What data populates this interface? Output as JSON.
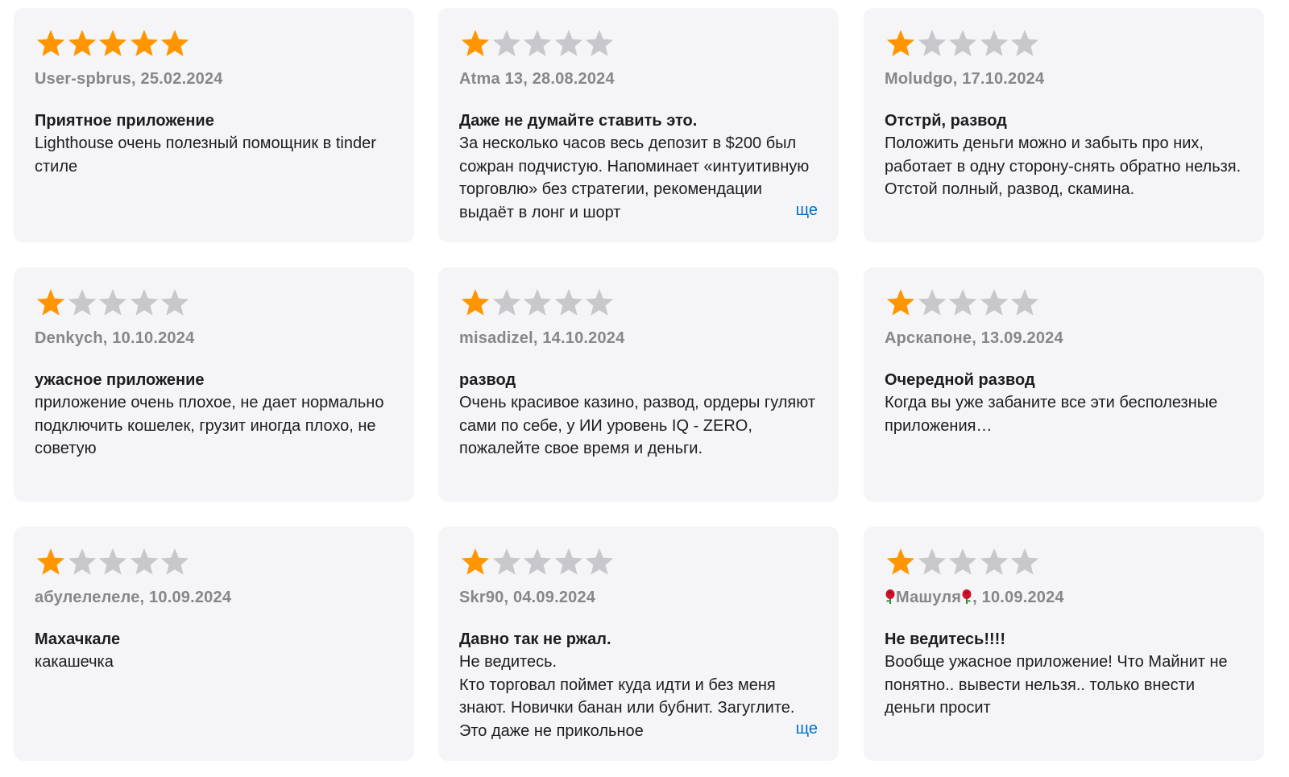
{
  "colors": {
    "star_filled": "#ff9500",
    "star_empty": "#c7c7cc",
    "link": "#0070c9"
  },
  "reviews": [
    {
      "rating": 5,
      "author": "User-spbrus",
      "date": "25.02.2024",
      "title": "Приятное приложение",
      "body": "Lighthouse очень полезный помощник в tinder стиле",
      "more": ""
    },
    {
      "rating": 1,
      "author": "Atma 13",
      "date": "28.08.2024",
      "title": "Даже не думайте ставить это.",
      "body": "За несколько часов весь депозит в $200 был сожран подчистую. Напоминает «интуитивную торговлю» без стратегии, рекомендации выдаёт в лонг и шорт",
      "more": "ще"
    },
    {
      "rating": 1,
      "author": "Moludgo",
      "date": "17.10.2024",
      "title": "Отстрй, развод",
      "body": "Положить деньги можно и забыть про них, работает в одну сторону-снять обратно нельзя. Отстой полный, развод, скамина.",
      "more": ""
    },
    {
      "rating": 1,
      "author": "Denkych",
      "date": "10.10.2024",
      "title": "ужасное приложение",
      "body": "приложение очень плохое, не дает нормально подключить кошелек, грузит иногда плохо, не советую",
      "more": ""
    },
    {
      "rating": 1,
      "author": "misadizel",
      "date": "14.10.2024",
      "title": "развод",
      "body": "Очень красивое казино, развод, ордеры гуляют сами по себе, у ИИ уровень IQ - ZERO, пожалейте свое время и деньги.",
      "more": ""
    },
    {
      "rating": 1,
      "author": "Арскапоне",
      "date": "13.09.2024",
      "title": "Очередной развод",
      "body": "Когда вы уже забаните все эти бесполезные приложения…",
      "more": ""
    },
    {
      "rating": 1,
      "author": "абулелелеле",
      "date": "10.09.2024",
      "title": "Махачкале",
      "body": "какашечка",
      "more": ""
    },
    {
      "rating": 1,
      "author": "Skr90",
      "date": "04.09.2024",
      "title": "Давно так не ржал.",
      "body": "Не ведитесь.\nКто торговал поймет куда идти и без меня знают. Новички банан или бубнит. Загуглите. Это даже не прикольное",
      "more": "ще"
    },
    {
      "rating": 1,
      "author": "Машуля",
      "author_icons": [
        "rose-icon",
        "rose-icon"
      ],
      "date": "10.09.2024",
      "title": "Не ведитесь!!!!",
      "body": "Вообще ужасное приложение! Что Майнит не понятно.. вывести нельзя.. только внести деньги просит",
      "more": ""
    }
  ]
}
